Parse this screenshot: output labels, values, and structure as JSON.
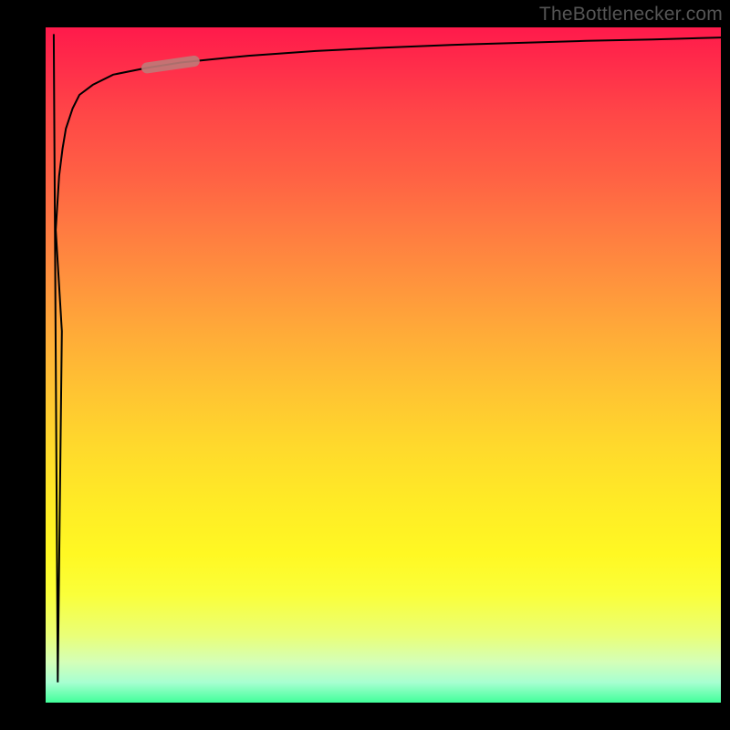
{
  "watermark": {
    "text": "TheBottlenecker.com"
  },
  "colors": {
    "frame_bg": "#000000",
    "gradient_top": "#ff1a4b",
    "gradient_mid_upper": "#ff7b41",
    "gradient_mid": "#ffd92c",
    "gradient_mid_lower": "#fff823",
    "gradient_bottom": "#41ff9a",
    "curve_stroke": "#000000",
    "highlight_stroke": "#bf7a78",
    "watermark_color": "#555555"
  },
  "chart_data": {
    "type": "line",
    "title": "",
    "xlabel": "",
    "ylabel": "",
    "xlim": [
      0,
      100
    ],
    "ylim": [
      0,
      100
    ],
    "x": [
      0,
      0.5,
      1,
      1.5,
      2,
      2.5,
      3,
      4,
      5,
      7,
      10,
      15,
      20,
      25,
      30,
      40,
      50,
      60,
      70,
      80,
      90,
      100
    ],
    "values": [
      0,
      30,
      55,
      70,
      78,
      82,
      85,
      88,
      90,
      91.5,
      93,
      94,
      94.8,
      95.3,
      95.8,
      96.5,
      97,
      97.4,
      97.7,
      98,
      98.2,
      98.5
    ],
    "highlight_region": {
      "x_start": 15,
      "x_end": 22,
      "y_start": 94,
      "y_end": 95
    },
    "annotations": []
  }
}
